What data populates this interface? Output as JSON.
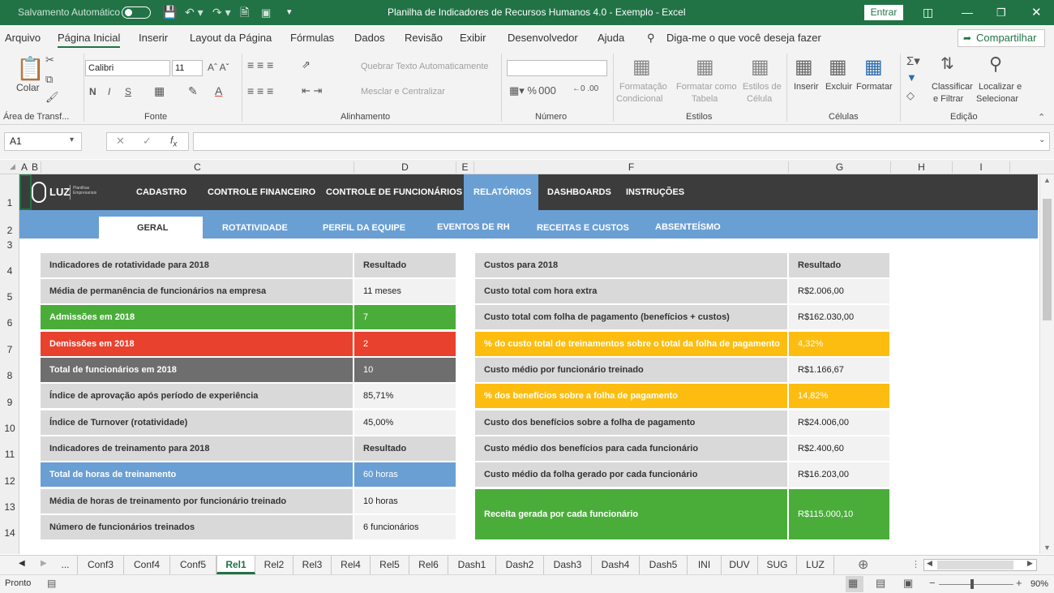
{
  "window": {
    "autosave": "Salvamento Automático",
    "title": "Planilha de Indicadores de Recursos Humanos 4.0 - Exemplo  -  Excel",
    "signin": "Entrar"
  },
  "menu": [
    "Arquivo",
    "Página Inicial",
    "Inserir",
    "Layout da Página",
    "Fórmulas",
    "Dados",
    "Revisão",
    "Exibir",
    "Desenvolvedor",
    "Ajuda"
  ],
  "tellme": "Diga-me o que você deseja fazer",
  "share": "Compartilhar",
  "ribbon": {
    "paste": "Colar",
    "clipboard": "Área de Transf...",
    "font_name": "Calibri",
    "font_size": "11",
    "font_group": "Fonte",
    "wrap": "Quebrar Texto Automaticamente",
    "merge": "Mesclar e Centralizar",
    "align_group": "Alinhamento",
    "number_group": "Número",
    "cond1": "Formatação",
    "cond2": "Condicional",
    "table1": "Formatar como",
    "table2": "Tabela",
    "style1": "Estilos de",
    "style2": "Célula",
    "styles_group": "Estilos",
    "insert": "Inserir",
    "delete": "Excluir",
    "format": "Formatar",
    "cells_group": "Células",
    "sort1": "Classificar",
    "sort2": "e Filtrar",
    "find1": "Localizar e",
    "find2": "Selecionar",
    "edit_group": "Edição"
  },
  "namebox": "A1",
  "columns": [
    "A",
    "B",
    "C",
    "D",
    "E",
    "F",
    "G",
    "H",
    "I"
  ],
  "rows": [
    "1",
    "2",
    "3",
    "4",
    "5",
    "6",
    "7",
    "8",
    "9",
    "10",
    "11",
    "12",
    "13",
    "14"
  ],
  "nav": {
    "logo": "LUZ",
    "logo_sub1": "Planilhas",
    "logo_sub2": "Empresariais",
    "items": [
      "CADASTRO",
      "CONTROLE FINANCEIRO",
      "CONTROLE DE FUNCIONÁRIOS",
      "RELATÓRIOS",
      "DASHBOARDS",
      "INSTRUÇÕES"
    ]
  },
  "subnav": [
    "GERAL",
    "ROTATIVIDADE",
    "PERFIL DA EQUIPE",
    "EVENTOS DE RH",
    "RECEITAS E CUSTOS",
    "ABSENTEÍSMO"
  ],
  "left_table": [
    {
      "label": "Indicadores de rotatividade para 2018",
      "value": "Resultado",
      "style": "lg",
      "vstyle": "lg"
    },
    {
      "label": "Média de permanência de funcionários na empresa",
      "value": "11 meses",
      "style": "lg",
      "vstyle": "lv"
    },
    {
      "label": "Admissões em 2018",
      "value": "7",
      "style": "green",
      "vstyle": "vgreen"
    },
    {
      "label": "Demissões em 2018",
      "value": "2",
      "style": "red",
      "vstyle": "vred"
    },
    {
      "label": "Total de funcionários em 2018",
      "value": "10",
      "style": "dark",
      "vstyle": "vdark"
    },
    {
      "label": "Índice de aprovação após período de experiência",
      "value": "85,71%",
      "style": "lg",
      "vstyle": "lv"
    },
    {
      "label": "Índice de Turnover (rotatividade)",
      "value": "45,00%",
      "style": "lg",
      "vstyle": "lv"
    },
    {
      "label": "Indicadores de treinamento para 2018",
      "value": "Resultado",
      "style": "lg",
      "vstyle": "lg"
    },
    {
      "label": "Total de horas de treinamento",
      "value": "60 horas",
      "style": "blue",
      "vstyle": "vblue"
    },
    {
      "label": "Média de horas de treinamento por funcionário treinado",
      "value": "10 horas",
      "style": "lg",
      "vstyle": "lv"
    },
    {
      "label": "Número de funcionários treinados",
      "value": "6 funcionários",
      "style": "lg",
      "vstyle": "lv"
    }
  ],
  "right_table": [
    {
      "label": "Custos para 2018",
      "value": "Resultado",
      "style": "lg",
      "vstyle": "lg"
    },
    {
      "label": "Custo total com hora extra",
      "value": "R$2.006,00",
      "style": "lg",
      "vstyle": "lv"
    },
    {
      "label": "Custo total com folha de pagamento (benefícios + custos)",
      "value": "R$162.030,00",
      "style": "lg",
      "vstyle": "lv"
    },
    {
      "label": "% do custo total de treinamentos sobre o total da folha de pagamento",
      "value": "4,32%",
      "style": "yellow",
      "vstyle": "vyellow"
    },
    {
      "label": "Custo médio por funcionário treinado",
      "value": "R$1.166,67",
      "style": "lg",
      "vstyle": "lv"
    },
    {
      "label": "% dos benefícios sobre a folha de pagamento",
      "value": "14,82%",
      "style": "yellow",
      "vstyle": "vyellow"
    },
    {
      "label": "Custo dos benefícios sobre a folha de pagamento",
      "value": "R$24.006,00",
      "style": "lg",
      "vstyle": "lv"
    },
    {
      "label": "Custo médio dos benefícios para cada funcionário",
      "value": "R$2.400,60",
      "style": "lg",
      "vstyle": "lv"
    },
    {
      "label": "Custo médio da folha gerado por cada funcionário",
      "value": "R$16.203,00",
      "style": "lg",
      "vstyle": "lv"
    },
    {
      "label": "Receita gerada por cada funcionário",
      "value": "R$115.000,10",
      "style": "green",
      "vstyle": "vgreen"
    }
  ],
  "sheet_tabs": [
    "...",
    "Conf3",
    "Conf4",
    "Conf5",
    "Rel1",
    "Rel2",
    "Rel3",
    "Rel4",
    "Rel5",
    "Rel6",
    "Dash1",
    "Dash2",
    "Dash3",
    "Dash4",
    "Dash5",
    "INI",
    "DUV",
    "SUG",
    "LUZ"
  ],
  "active_tab": "Rel1",
  "status": {
    "ready": "Pronto",
    "zoom": "90%"
  },
  "colors": {
    "excel_green": "#217346",
    "nav_dark": "#3c3c3c",
    "nav_blue": "#6a9fd4",
    "green": "#4aad3a",
    "red": "#e8412e",
    "yellow": "#fdbd10"
  }
}
